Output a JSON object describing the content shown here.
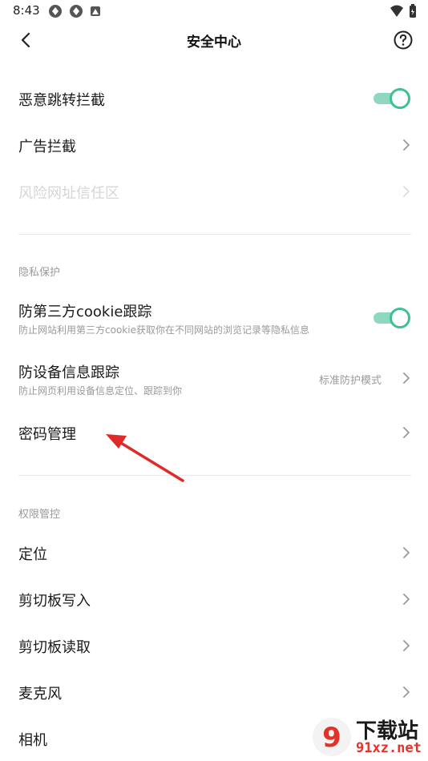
{
  "status_bar": {
    "time": "8:43"
  },
  "header": {
    "title": "安全中心"
  },
  "items": {
    "malicious_redirect": {
      "label": "恶意跳转拦截",
      "enabled": true
    },
    "ad_block": {
      "label": "广告拦截"
    },
    "risk_trust": {
      "label": "风险网址信任区"
    },
    "third_party_cookie": {
      "label": "防第三方cookie跟踪",
      "desc": "防止网站利用第三方cookie获取你在不同网站的浏览记录等隐私信息",
      "enabled": true
    },
    "device_tracking": {
      "label": "防设备信息跟踪",
      "desc": "防止网页利用设备信息定位、跟踪到你",
      "value": "标准防护模式"
    },
    "password": {
      "label": "密码管理"
    },
    "location": {
      "label": "定位"
    },
    "clipboard_write": {
      "label": "剪切板写入"
    },
    "clipboard_read": {
      "label": "剪切板读取"
    },
    "microphone": {
      "label": "麦克风"
    },
    "camera": {
      "label": "相机"
    }
  },
  "sections": {
    "privacy": "隐私保护",
    "permissions": "权限管控"
  },
  "watermark": {
    "text": "下载站",
    "domain": "91xz.net"
  },
  "colors": {
    "accent": "#3fbf94",
    "accent_light": "#8fd8c0",
    "annotation_arrow": "#e02a2a"
  }
}
